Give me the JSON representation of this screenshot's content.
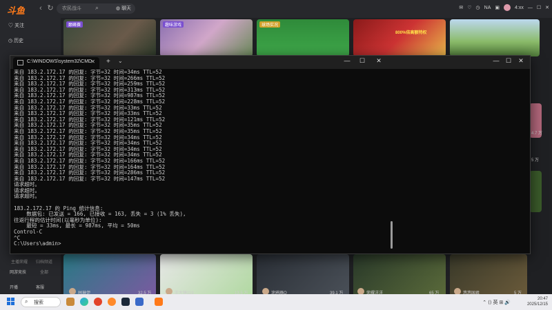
{
  "app": {
    "search_placeholder": "农民战斗",
    "topic_label": "聊天",
    "top_status": "NA",
    "top_time": "4:xx"
  },
  "sidebar": {
    "items": [
      {
        "label": "关注"
      },
      {
        "label": "历史"
      }
    ],
    "bottom_labels": [
      "主播荣耀",
      "归档频道",
      "网游竞技",
      "全部",
      "开播",
      "客服"
    ]
  },
  "top_thumbs": [
    {
      "tag": "巅峰赛"
    },
    {
      "tag": "趣味游戏"
    },
    {
      "tag": "球场实况"
    },
    {
      "tag": "800%倍高额特权"
    },
    {
      "tag": ""
    }
  ],
  "bottom_thumbs": [
    {
      "name": "林琳伊",
      "count": "32.5 万"
    },
    {
      "name": "王大锤119",
      "count": "13.5 万"
    },
    {
      "name": "涂鸦器Q",
      "count": "39.1 万"
    },
    {
      "name": "荣耀洋洋",
      "count": "65 万"
    },
    {
      "name": "悠悠国君",
      "count": "5 万"
    }
  ],
  "side_right_counts": [
    "4.7 万",
    "5 万"
  ],
  "cmd": {
    "title": "C:\\WINDOWS\\system32\\CMD",
    "lines": [
      "来自 183.2.172.17 的回复: 字节=32 时间=34ms TTL=52",
      "来自 183.2.172.17 的回复: 字节=32 时间=266ms TTL=52",
      "来自 183.2.172.17 的回复: 字节=32 时间=259ms TTL=52",
      "来自 183.2.172.17 的回复: 字节=32 时间=313ms TTL=52",
      "来自 183.2.172.17 的回复: 字节=32 时间=987ms TTL=52",
      "来自 183.2.172.17 的回复: 字节=32 时间=228ms TTL=52",
      "来自 183.2.172.17 的回复: 字节=32 时间=33ms TTL=52",
      "来自 183.2.172.17 的回复: 字节=32 时间=33ms TTL=52",
      "来自 183.2.172.17 的回复: 字节=32 时间=121ms TTL=52",
      "来自 183.2.172.17 的回复: 字节=32 时间=35ms TTL=52",
      "来自 183.2.172.17 的回复: 字节=32 时间=35ms TTL=52",
      "来自 183.2.172.17 的回复: 字节=32 时间=34ms TTL=52",
      "来自 183.2.172.17 的回复: 字节=32 时间=34ms TTL=52",
      "来自 183.2.172.17 的回复: 字节=32 时间=34ms TTL=52",
      "来自 183.2.172.17 的回复: 字节=32 时间=34ms TTL=52",
      "来自 183.2.172.17 的回复: 字节=32 时间=166ms TTL=52",
      "来自 183.2.172.17 的回复: 字节=32 时间=164ms TTL=52",
      "来自 183.2.172.17 的回复: 字节=32 时间=286ms TTL=52",
      "来自 183.2.172.17 的回复: 字节=32 时间=147ms TTL=52",
      "请求超时。",
      "请求超时。",
      "请求超时。",
      "",
      "183.2.172.17 的 Ping 统计信息:",
      "    数据包: 已发送 = 166, 已接收 = 163, 丢失 = 3 (1% 丢失),",
      "往返行程的估计时间(以毫秒为单位):",
      "    最短 = 33ms, 最长 = 987ms, 平均 = 50ms",
      "Control-C",
      "^C",
      "C:\\Users\\admin>"
    ]
  },
  "taskbar": {
    "search_label": "搜索",
    "lang": "英",
    "time": "20:47",
    "date": "2025/12/15"
  }
}
